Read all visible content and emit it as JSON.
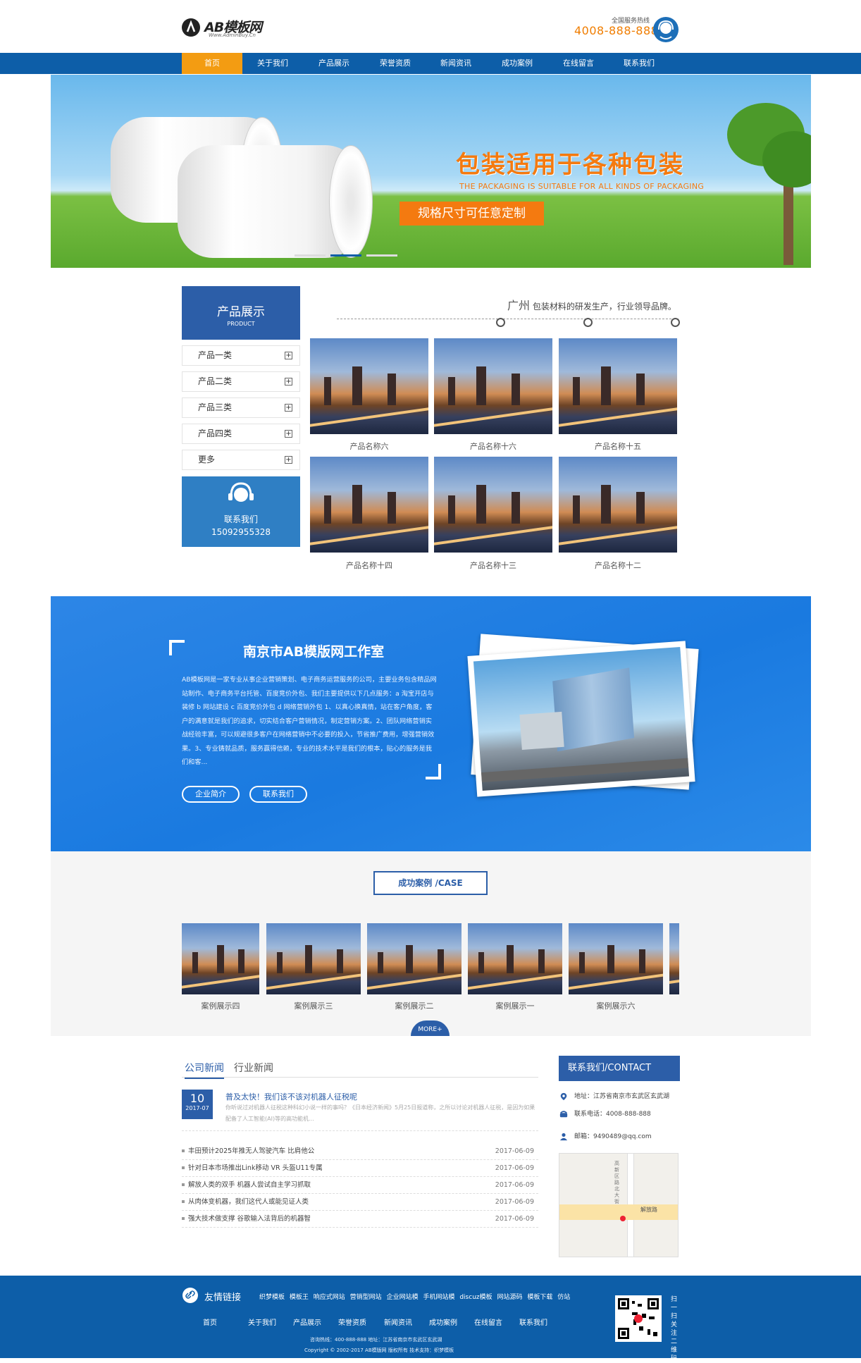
{
  "header": {
    "logo_text": "AB模板网",
    "logo_url": "Www.AdminBuy.Cn",
    "hotline_label": "全国服务热线",
    "hotline": "4008-888-888"
  },
  "nav": [
    "首页",
    "关于我们",
    "产品展示",
    "荣誉资质",
    "新闻资讯",
    "成功案例",
    "在线留言",
    "联系我们"
  ],
  "banner": {
    "title": "包装适用于各种包装",
    "subtitle": "THE PACKAGING IS SUITABLE FOR ALL KINDS OF PACKAGING",
    "button": "规格尺寸可任意定制",
    "active_slide": 2,
    "slides": 3
  },
  "products": {
    "side_title": "产品展示",
    "side_sub": "PRODUCT",
    "categories": [
      "产品一类",
      "产品二类",
      "产品三类",
      "产品四类",
      "更多"
    ],
    "contact_label": "联系我们",
    "contact_phone": "15092955328",
    "tagline_city": "广州",
    "tagline": "包装材料的研发生产，行业领导品牌。",
    "items": [
      "产品名称六",
      "产品名称十六",
      "产品名称十五",
      "产品名称十四",
      "产品名称十三",
      "产品名称十二"
    ]
  },
  "about": {
    "title": "南京市AB模版网工作室",
    "text": "AB模板网是一家专业从事企业营销策划、电子商务运营服务的公司，主要业务包含精品网站制作、电子商务平台托管、百度竞价外包、我们主要提供以下几点服务：a 淘宝开店与装修 b 网站建设 c 百度竞价外包 d 网络营销外包 1、以真心换真情，站在客户角度，客户的满意就是我们的追求，切实结合客户营销情况，制定营销方案。2、团队网络营销实战经验丰富，可以规避很多客户在网络营销中不必要的投入，节省推广费用，增强营销效果。3、专业铸就品质，服务赢得信赖，专业的技术水平是我们的根本，贴心的服务是我们和客...",
    "btn_intro": "企业简介",
    "btn_contact": "联系我们"
  },
  "cases": {
    "title": "成功案例",
    "title_en": "/CASE",
    "items": [
      "案例展示四",
      "案例展示三",
      "案例展示二",
      "案例展示一",
      "案例展示六"
    ],
    "more": "MORE+"
  },
  "news": {
    "tab_company": "公司新闻",
    "tab_industry": "行业新闻",
    "featured": {
      "day": "10",
      "month": "2017-07",
      "title": "普及太快！我们该不该对机器人征税呢",
      "desc": "你听说过对机器人征税这种科幻小说一样的事吗？《日本经济新闻》5月25日报道称，之所以讨论对机器人征税，是因为如果配备了人工智能(AI)等的高功能机..."
    },
    "rows": [
      {
        "title": "丰田预计2025年推无人驾驶汽车 比肩他公",
        "date": "2017-06-09"
      },
      {
        "title": "针对日本市场推出Link移动 VR 头盔U11专属",
        "date": "2017-06-09"
      },
      {
        "title": "解放人类的双手 机器人尝试自主学习抓取",
        "date": "2017-06-09"
      },
      {
        "title": "从肉体变机器，我们这代人或能见证人类",
        "date": "2017-06-09"
      },
      {
        "title": "强大技术做支撑 谷歌输入法背后的机器智",
        "date": "2017-06-09"
      }
    ]
  },
  "contact": {
    "title": "联系我们/CONTACT",
    "address": "地址：江苏省南京市玄武区玄武湖",
    "phone": "联系电话：4008-888-888",
    "email": "邮箱：9490489@qq.com",
    "map_road": "解放路",
    "map_street": "高新区路北大街"
  },
  "footer": {
    "friend_label": "友情链接",
    "links": [
      "织梦模板",
      "模板王",
      "响应式网站",
      "营销型网站",
      "企业网站模",
      "手机网站模",
      "discuz模板",
      "网站源码",
      "模板下载",
      "仿站"
    ],
    "nav": [
      "首页",
      "关于我们",
      "产品展示",
      "荣誉资质",
      "新闻资讯",
      "成功案例",
      "在线留言",
      "联系我们"
    ],
    "info": "咨询热线：400-888-888 地址：江苏省南京市玄武区玄武湖",
    "copyright": "Copyright © 2002-2017 AB模版网 版权所有 技术支持：织梦模板",
    "qr_text": "扫一扫关注二维码"
  }
}
